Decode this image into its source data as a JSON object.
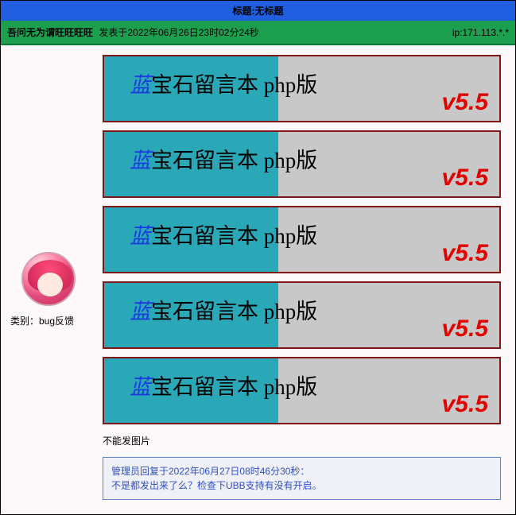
{
  "title_bar": "标题:无标题",
  "meta": {
    "author": "吾问无为谓旺旺旺旺",
    "posted": "发表于2022年06月26日23时02分24秒",
    "ip": "ip:171.113.*.*"
  },
  "sidebar": {
    "category": "类别：bug反馈"
  },
  "banner": {
    "title_blue": "蓝",
    "title_rest": "宝石留言本 php版",
    "version": "v5.5"
  },
  "message": {
    "text": "不能发图片"
  },
  "reply": {
    "header": "管理员回复于2022年06月27日08时46分30秒：",
    "body": "不是都发出来了么？检查下UBB支持有没有开启。"
  }
}
